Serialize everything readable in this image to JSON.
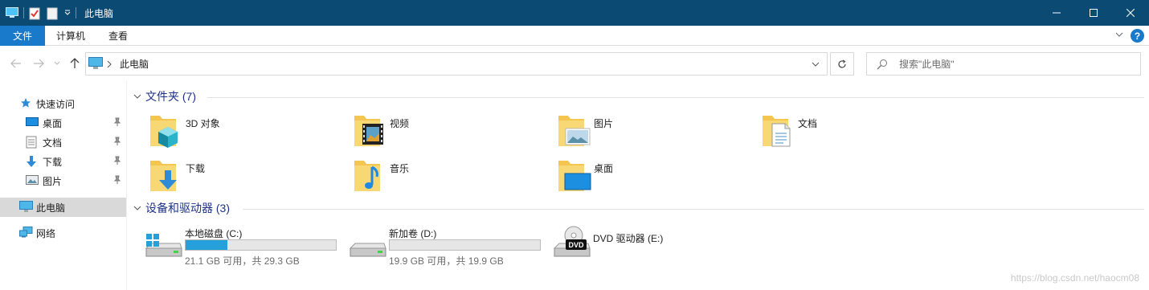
{
  "window": {
    "title": "此电脑"
  },
  "ribbon": {
    "tabs": [
      "文件",
      "计算机",
      "查看"
    ],
    "help": "?"
  },
  "nav": {
    "path_root": "此电脑",
    "search_placeholder": "搜索\"此电脑\""
  },
  "sidebar": {
    "items": [
      {
        "label": "快速访问",
        "icon": "star-icon",
        "pinned": false
      },
      {
        "label": "桌面",
        "icon": "desktop-icon",
        "pinned": true
      },
      {
        "label": "文档",
        "icon": "document-icon",
        "pinned": true
      },
      {
        "label": "下载",
        "icon": "download-icon",
        "pinned": true
      },
      {
        "label": "图片",
        "icon": "picture-icon",
        "pinned": true
      },
      {
        "label": "此电脑",
        "icon": "computer-icon",
        "pinned": false,
        "selected": true
      },
      {
        "label": "网络",
        "icon": "network-icon",
        "pinned": false
      }
    ]
  },
  "folders_section": {
    "header": "文件夹 (7)",
    "items": [
      {
        "label": "3D 对象",
        "icon": "3d-objects-folder-icon"
      },
      {
        "label": "视频",
        "icon": "videos-folder-icon"
      },
      {
        "label": "图片",
        "icon": "pictures-folder-icon"
      },
      {
        "label": "文档",
        "icon": "documents-folder-icon"
      },
      {
        "label": "下载",
        "icon": "downloads-folder-icon"
      },
      {
        "label": "音乐",
        "icon": "music-folder-icon"
      },
      {
        "label": "桌面",
        "icon": "desktop-folder-icon"
      }
    ]
  },
  "drives_section": {
    "header": "设备和驱动器 (3)",
    "items": [
      {
        "label": "本地磁盘 (C:)",
        "icon": "windows-drive-icon",
        "used_fraction": 0.28,
        "info": "21.1 GB 可用，共 29.3 GB"
      },
      {
        "label": "新加卷 (D:)",
        "icon": "drive-icon",
        "used_fraction": 0.0,
        "info": "19.9 GB 可用，共 19.9 GB"
      },
      {
        "label": "DVD 驱动器 (E:)",
        "icon": "dvd-drive-icon",
        "dvd_badge": "DVD"
      }
    ]
  },
  "watermark": "https://blog.csdn.net/haocm08",
  "colors": {
    "titlebar": "#0a4a73",
    "accent": "#1979ca",
    "bar_fill": "#26a0da",
    "folder": "#f4c650",
    "section_header": "#1e3287"
  }
}
